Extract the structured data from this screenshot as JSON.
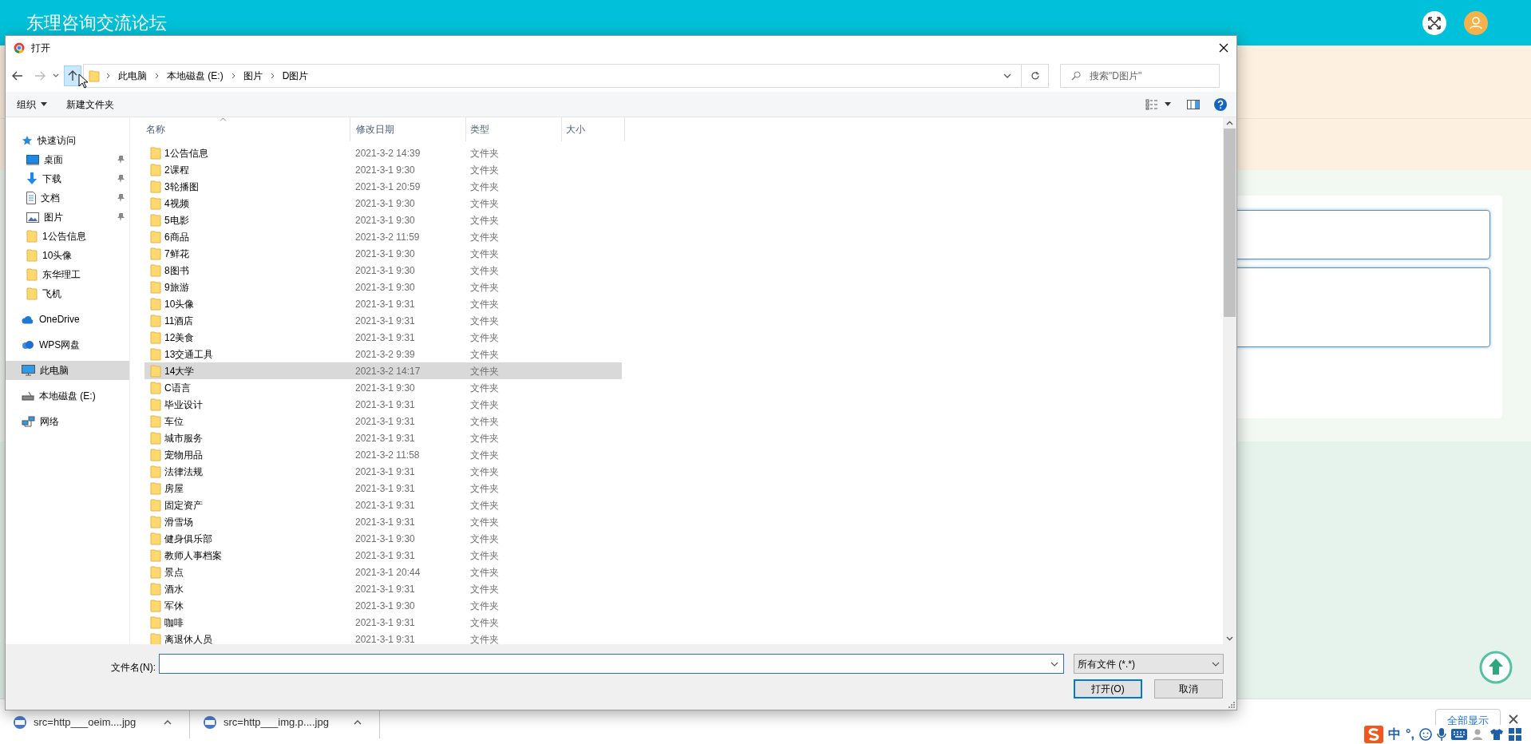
{
  "site": {
    "title": "东理咨询交流论坛"
  },
  "dialog": {
    "title": "打开",
    "breadcrumb": [
      "此电脑",
      "本地磁盘 (E:)",
      "图片",
      "D图片"
    ],
    "search": {
      "placeholder": "搜索\"D图片\""
    },
    "toolbar": [
      {
        "label": "组织",
        "kind": "menu"
      },
      {
        "label": "新建文件夹",
        "kind": "button"
      }
    ],
    "sidebar": [
      {
        "label": "快速访问",
        "kind": "star",
        "selected": false,
        "children": [
          {
            "label": "桌面",
            "kind": "desktop",
            "pinned": true,
            "selected": false
          },
          {
            "label": "下载",
            "kind": "download",
            "pinned": true,
            "selected": false
          },
          {
            "label": "文档",
            "kind": "document",
            "pinned": true,
            "selected": false
          },
          {
            "label": "图片",
            "kind": "picture",
            "pinned": true,
            "selected": false
          },
          {
            "label": "1公告信息",
            "kind": "folder",
            "pinned": false,
            "selected": false
          },
          {
            "label": "10头像",
            "kind": "folder",
            "pinned": false,
            "selected": false
          },
          {
            "label": "东华理工",
            "kind": "folder",
            "pinned": false,
            "selected": false
          },
          {
            "label": "飞机",
            "kind": "folder",
            "pinned": false,
            "selected": false
          }
        ]
      },
      {
        "label": "OneDrive",
        "kind": "cloud",
        "selected": false
      },
      {
        "label": "WPS网盘",
        "kind": "cloud2",
        "selected": false
      },
      {
        "label": "此电脑",
        "kind": "computer",
        "selected": true
      },
      {
        "label": "本地磁盘 (E:)",
        "kind": "drive",
        "selected": false
      },
      {
        "label": "网络",
        "kind": "network",
        "selected": false
      }
    ],
    "columns": [
      "名称",
      "修改日期",
      "类型",
      "大小"
    ],
    "rows": [
      {
        "name": "1公告信息",
        "modified": "2021-3-2 14:39",
        "type": "文件夹",
        "selected": false
      },
      {
        "name": "2课程",
        "modified": "2021-3-1 9:30",
        "type": "文件夹",
        "selected": false
      },
      {
        "name": "3轮播图",
        "modified": "2021-3-1 20:59",
        "type": "文件夹",
        "selected": false
      },
      {
        "name": "4视频",
        "modified": "2021-3-1 9:30",
        "type": "文件夹",
        "selected": false
      },
      {
        "name": "5电影",
        "modified": "2021-3-1 9:30",
        "type": "文件夹",
        "selected": false
      },
      {
        "name": "6商品",
        "modified": "2021-3-2 11:59",
        "type": "文件夹",
        "selected": false
      },
      {
        "name": "7鲜花",
        "modified": "2021-3-1 9:30",
        "type": "文件夹",
        "selected": false
      },
      {
        "name": "8图书",
        "modified": "2021-3-1 9:30",
        "type": "文件夹",
        "selected": false
      },
      {
        "name": "9旅游",
        "modified": "2021-3-1 9:30",
        "type": "文件夹",
        "selected": false
      },
      {
        "name": "10头像",
        "modified": "2021-3-1 9:31",
        "type": "文件夹",
        "selected": false
      },
      {
        "name": "11酒店",
        "modified": "2021-3-1 9:31",
        "type": "文件夹",
        "selected": false
      },
      {
        "name": "12美食",
        "modified": "2021-3-1 9:31",
        "type": "文件夹",
        "selected": false
      },
      {
        "name": "13交通工具",
        "modified": "2021-3-2 9:39",
        "type": "文件夹",
        "selected": false
      },
      {
        "name": "14大学",
        "modified": "2021-3-2 14:17",
        "type": "文件夹",
        "selected": true
      },
      {
        "name": "C语言",
        "modified": "2021-3-1 9:30",
        "type": "文件夹",
        "selected": false
      },
      {
        "name": "毕业设计",
        "modified": "2021-3-1 9:31",
        "type": "文件夹",
        "selected": false
      },
      {
        "name": "车位",
        "modified": "2021-3-1 9:31",
        "type": "文件夹",
        "selected": false
      },
      {
        "name": "城市服务",
        "modified": "2021-3-1 9:31",
        "type": "文件夹",
        "selected": false
      },
      {
        "name": "宠物用品",
        "modified": "2021-3-2 11:58",
        "type": "文件夹",
        "selected": false
      },
      {
        "name": "法律法规",
        "modified": "2021-3-1 9:31",
        "type": "文件夹",
        "selected": false
      },
      {
        "name": "房屋",
        "modified": "2021-3-1 9:31",
        "type": "文件夹",
        "selected": false
      },
      {
        "name": "固定资产",
        "modified": "2021-3-1 9:31",
        "type": "文件夹",
        "selected": false
      },
      {
        "name": "滑雪场",
        "modified": "2021-3-1 9:31",
        "type": "文件夹",
        "selected": false
      },
      {
        "name": "健身俱乐部",
        "modified": "2021-3-1 9:30",
        "type": "文件夹",
        "selected": false
      },
      {
        "name": "教师人事档案",
        "modified": "2021-3-1 9:31",
        "type": "文件夹",
        "selected": false
      },
      {
        "name": "景点",
        "modified": "2021-3-1 20:44",
        "type": "文件夹",
        "selected": false
      },
      {
        "name": "酒水",
        "modified": "2021-3-1 9:31",
        "type": "文件夹",
        "selected": false
      },
      {
        "name": "军休",
        "modified": "2021-3-1 9:30",
        "type": "文件夹",
        "selected": false
      },
      {
        "name": "咖啡",
        "modified": "2021-3-1 9:31",
        "type": "文件夹",
        "selected": false
      },
      {
        "name": "离退休人员",
        "modified": "2021-3-1 9:31",
        "type": "文件夹",
        "selected": false
      }
    ],
    "filename_label": "文件名(N):",
    "file_type": "所有文件 (*.*)",
    "buttons": [
      {
        "label": "打开(O)",
        "default": true
      },
      {
        "label": "取消",
        "default": false
      }
    ]
  },
  "downloads": [
    {
      "name": "src=http___oeim....jpg"
    },
    {
      "name": "src=http___img.p....jpg"
    }
  ],
  "show_all": "全部显示",
  "ime": [
    "中",
    "°,"
  ]
}
